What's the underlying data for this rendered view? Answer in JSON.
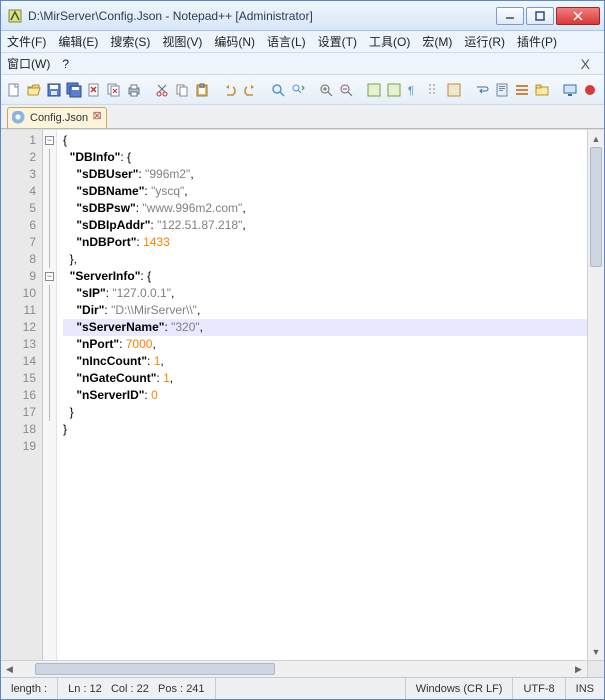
{
  "title": "D:\\MirServer\\Config.Json - Notepad++ [Administrator]",
  "menu1": [
    "文件(F)",
    "编辑(E)",
    "搜索(S)",
    "视图(V)",
    "编码(N)",
    "语言(L)",
    "设置(T)",
    "工具(O)",
    "宏(M)",
    "运行(R)",
    "插件(P)"
  ],
  "menu2": [
    "窗口(W)",
    "?"
  ],
  "tab": {
    "label": "Config.Json",
    "close": "⊠"
  },
  "linecount": 19,
  "highlight_line": 12,
  "fold_open_lines": [
    1,
    9
  ],
  "file": {
    "DBInfo": {
      "sDBUser": "996m2",
      "sDBName": "yscq",
      "sDBPsw": "www.996m2.com",
      "sDBIpAddr": "122.51.87.218",
      "nDBPort": 1433
    },
    "ServerInfo": {
      "sIP": "127.0.0.1",
      "Dir": "D:\\\\MirServer\\\\",
      "sServerName": "320",
      "nPort": 7000,
      "nIncCount": 1,
      "nGateCount": 1,
      "nServerID": 0
    }
  },
  "status": {
    "length_label": "length :",
    "ln_label": "Ln :",
    "ln": "12",
    "col_label": "Col :",
    "col": "22",
    "pos_label": "Pos :",
    "pos": "241",
    "eol": "Windows (CR LF)",
    "enc": "UTF-8",
    "ins": "INS"
  },
  "icons": {
    "app": "notepadpp-icon",
    "min": "minimize-icon",
    "max": "maximize-icon",
    "close": "close-icon",
    "new": "new-file-icon",
    "open": "open-folder-icon",
    "save": "save-icon",
    "saveall": "save-all-icon",
    "closef": "close-file-icon",
    "closeall": "close-all-icon",
    "print": "print-icon",
    "cut": "cut-icon",
    "copy": "copy-icon",
    "paste": "paste-icon",
    "undo": "undo-icon",
    "redo": "redo-icon",
    "find": "find-icon",
    "replace": "replace-icon",
    "zoomin": "zoom-in-icon",
    "zoomout": "zoom-out-icon",
    "ws": "show-ws-icon",
    "wrap": "word-wrap-icon",
    "guide": "indent-guide-icon",
    "lang": "user-lang-icon",
    "docmap": "doc-map-icon",
    "funclist": "func-list-icon",
    "folder": "folder-view-icon",
    "monitor": "monitor-icon",
    "record": "record-macro-icon",
    "play": "play-macro-icon"
  }
}
